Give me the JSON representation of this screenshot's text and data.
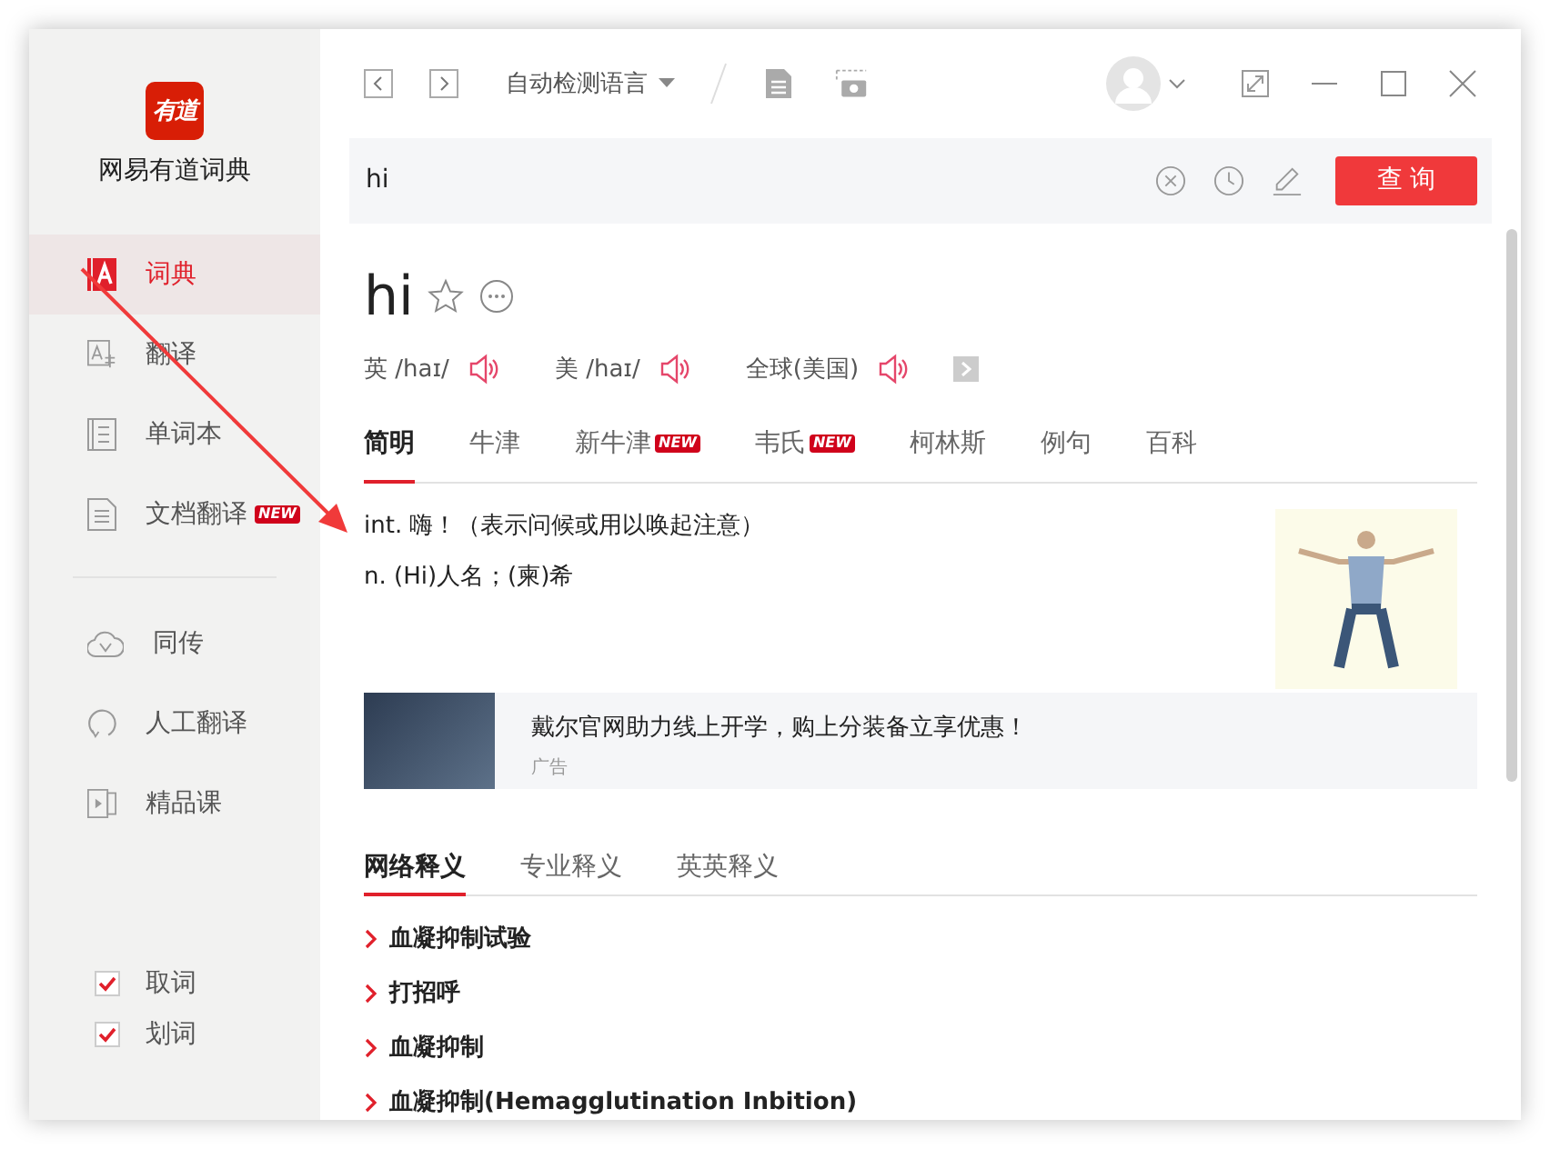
{
  "sidebar": {
    "logo_text": "有道",
    "app_name": "网易有道词典",
    "nav_items": [
      {
        "label": "词典",
        "selected": true
      },
      {
        "label": "翻译",
        "selected": false
      },
      {
        "label": "单词本",
        "selected": false
      },
      {
        "label": "文档翻译",
        "selected": false,
        "badge": "NEW"
      }
    ],
    "nav_items_2": [
      {
        "label": "同传",
        "selected": false
      },
      {
        "label": "人工翻译",
        "selected": false
      },
      {
        "label": "精品课",
        "selected": false
      }
    ],
    "options": [
      {
        "label": "取词",
        "checked": true
      },
      {
        "label": "划词",
        "checked": true
      }
    ]
  },
  "toolbar": {
    "language": "自动检测语言"
  },
  "search": {
    "value": "hi",
    "button": "查 询"
  },
  "entry": {
    "word": "hi",
    "pronunciations": [
      {
        "label": "英 /haɪ/"
      },
      {
        "label": "美 /haɪ/"
      },
      {
        "label": "全球(美国)"
      }
    ],
    "tabs": [
      {
        "label": "简明",
        "selected": true
      },
      {
        "label": "牛津",
        "selected": false
      },
      {
        "label": "新牛津",
        "selected": false,
        "badge": "NEW"
      },
      {
        "label": "韦氏",
        "selected": false,
        "badge": "NEW"
      },
      {
        "label": "柯林斯",
        "selected": false
      },
      {
        "label": "例句",
        "selected": false
      },
      {
        "label": "百科",
        "selected": false
      }
    ],
    "definitions": [
      "int. 嗨！（表示问候或用以唤起注意）",
      "n. (Hi)人名；(柬)希"
    ]
  },
  "ad": {
    "title": "戴尔官网助力线上开学，购上分装备立享优惠！",
    "label": "广告"
  },
  "web_tabs": [
    {
      "label": "网络释义",
      "selected": true
    },
    {
      "label": "专业释义",
      "selected": false
    },
    {
      "label": "英英释义",
      "selected": false
    }
  ],
  "web_definitions": [
    "血凝抑制试验",
    "打招呼",
    "血凝抑制",
    "血凝抑制(Hemagglutination Inbition)"
  ]
}
